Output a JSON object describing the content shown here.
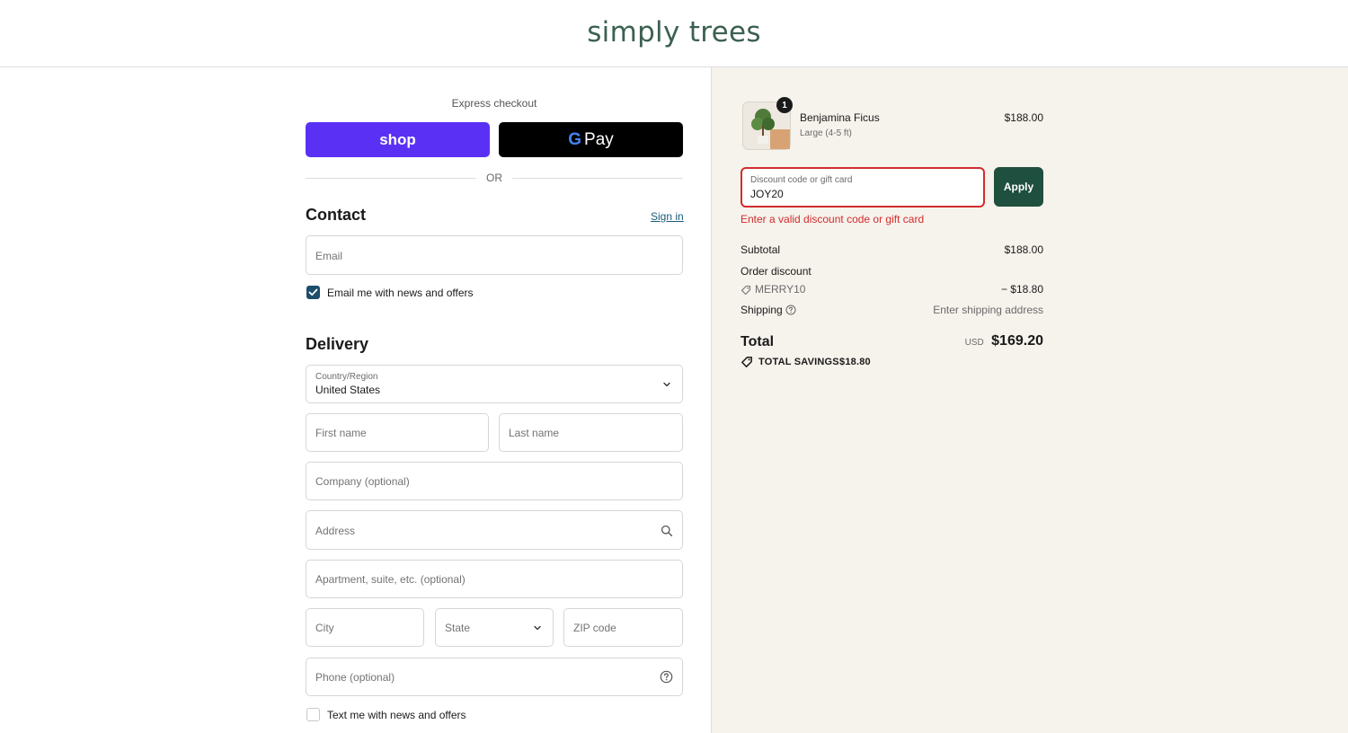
{
  "header": {
    "logo_text": "simply trees"
  },
  "express": {
    "label": "Express checkout",
    "shop_label": "shop",
    "gpay_g": "G",
    "gpay_label": "Pay",
    "or_label": "OR"
  },
  "contact": {
    "title": "Contact",
    "signin_label": "Sign in",
    "email_placeholder": "Email",
    "news_checkbox_label": "Email me with news and offers",
    "news_checked": true
  },
  "delivery": {
    "title": "Delivery",
    "country_label": "Country/Region",
    "country_value": "United States",
    "first_name_placeholder": "First name",
    "last_name_placeholder": "Last name",
    "company_placeholder": "Company (optional)",
    "address_placeholder": "Address",
    "apartment_placeholder": "Apartment, suite, etc. (optional)",
    "city_placeholder": "City",
    "state_placeholder": "State",
    "zip_placeholder": "ZIP code",
    "phone_placeholder": "Phone (optional)",
    "text_checkbox_label": "Text me with news and offers",
    "text_checked": false
  },
  "summary": {
    "product": {
      "name": "Benjamina Ficus",
      "variant": "Large (4-5 ft)",
      "price": "$188.00",
      "quantity": "1"
    },
    "discount": {
      "label": "Discount code or gift card",
      "value": "JOY20",
      "apply_label": "Apply",
      "error": "Enter a valid discount code or gift card"
    },
    "subtotal_label": "Subtotal",
    "subtotal_value": "$188.00",
    "order_discount_label": "Order discount",
    "discount_code": "MERRY10",
    "discount_amount": "− $18.80",
    "shipping_label": "Shipping",
    "shipping_value": "Enter shipping address",
    "total_label": "Total",
    "currency": "USD",
    "total_value": "$169.20",
    "savings_label": "TOTAL SAVINGS",
    "savings_value": "$18.80"
  },
  "colors": {
    "shop_purple": "#5a31f4",
    "apply_green": "#1f4f3e",
    "error_red": "#d12c2c",
    "checkbox_blue": "#1d4e6c",
    "summary_bg": "#f6f2ec",
    "logo_green": "#3c6151"
  }
}
